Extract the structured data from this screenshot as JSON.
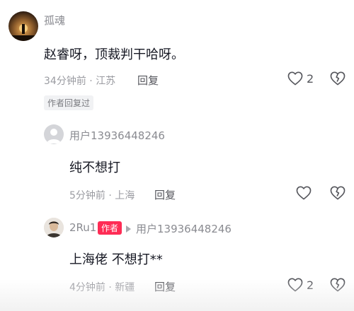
{
  "comments": [
    {
      "username": "孤魂",
      "text": "赵睿呀，顶裁判干哈呀。",
      "time": "34分钟前",
      "location": "江苏",
      "reply_label": "回复",
      "like_count": "2",
      "author_replied_label": "作者回复过",
      "icons": {
        "like": "heart-icon",
        "dislike": "broken-heart-icon"
      }
    }
  ],
  "replies": [
    {
      "username": "用户13936448246",
      "text": "纯不想打",
      "time": "5分钟前",
      "location": "上海",
      "reply_label": "回复",
      "like_count": ""
    },
    {
      "username": "2Ru1",
      "author_badge": "作者",
      "reply_to": "用户13936448246",
      "text": "上海佬 不想打**",
      "time": "4分钟前",
      "location": "新疆",
      "reply_label": "回复",
      "like_count": "2"
    }
  ],
  "separator": "·",
  "colors": {
    "accent": "#fe2c55",
    "text": "#161823",
    "muted": "#9a9ba1"
  }
}
